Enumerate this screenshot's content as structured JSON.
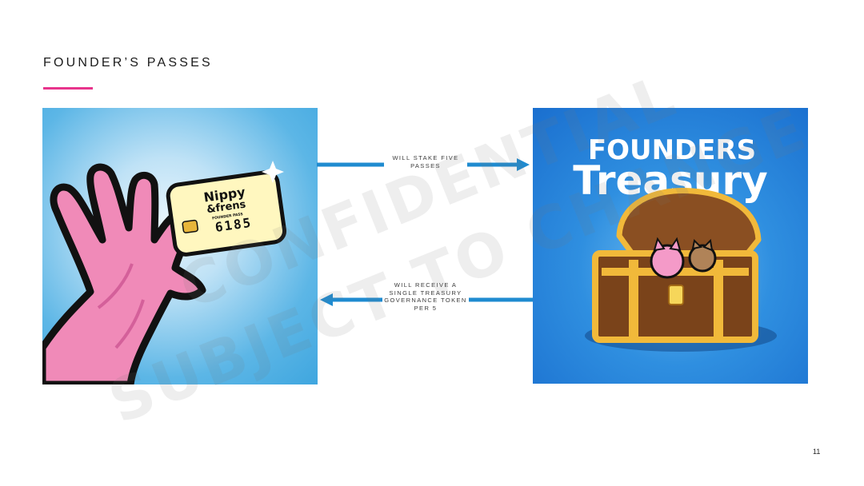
{
  "slide": {
    "title": "FOUNDER’S PASSES",
    "accent_color": "#e8348c",
    "page_number": "11"
  },
  "left_image": {
    "card": {
      "brand_line1": "Nippy",
      "brand_line2": "&frens",
      "subtitle": "FOUNDER PASS",
      "number": "6185"
    }
  },
  "right_image": {
    "heading_line1": "FOUNDERS",
    "heading_line2": "Treasury"
  },
  "flows": {
    "stake": {
      "label": "WILL STAKE FIVE PASSES",
      "direction": "right"
    },
    "receive": {
      "label": "WILL RECEIVE A SINGLE TREASURY GOVERNANCE TOKEN PER 5",
      "direction": "left"
    },
    "arrow_color": "#1f8bd0"
  },
  "watermark": {
    "line1": "CONFIDENTIAL",
    "line2": "SUBJECT TO CHANGE"
  }
}
